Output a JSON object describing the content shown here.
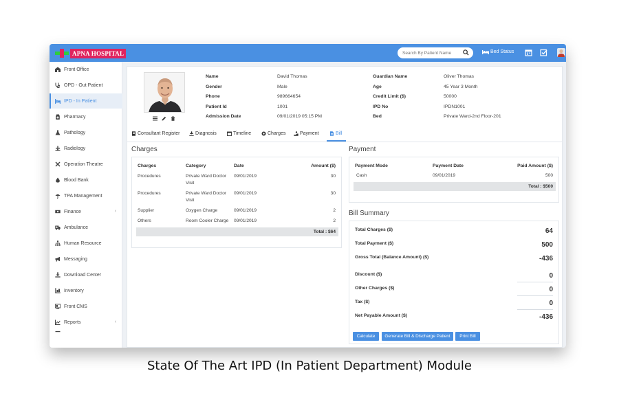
{
  "app": {
    "logo_text": "APNA HOSPITAL"
  },
  "topbar": {
    "search_placeholder": "Search By Patient Name",
    "bed_status": "Bed Status"
  },
  "sidebar": {
    "items": [
      {
        "label": "Front Office",
        "icon": "front-office-icon"
      },
      {
        "label": "OPD - Out Patient",
        "icon": "stethoscope-icon"
      },
      {
        "label": "IPD - In Patient",
        "icon": "bed-icon",
        "active": true
      },
      {
        "label": "Pharmacy",
        "icon": "pharmacy-icon"
      },
      {
        "label": "Pathology",
        "icon": "flask-icon"
      },
      {
        "label": "Radiology",
        "icon": "radiology-icon"
      },
      {
        "label": "Operation Theatre",
        "icon": "scissors-icon"
      },
      {
        "label": "Blood Bank",
        "icon": "blood-drop-icon"
      },
      {
        "label": "TPA Management",
        "icon": "umbrella-icon"
      },
      {
        "label": "Finance",
        "icon": "money-icon",
        "chevron": "‹"
      },
      {
        "label": "Ambulance",
        "icon": "ambulance-icon"
      },
      {
        "label": "Human Resource",
        "icon": "sitemap-icon"
      },
      {
        "label": "Messaging",
        "icon": "bullhorn-icon"
      },
      {
        "label": "Download Center",
        "icon": "download-icon"
      },
      {
        "label": "Inventory",
        "icon": "inventory-icon"
      },
      {
        "label": "Front CMS",
        "icon": "cms-icon"
      },
      {
        "label": "Reports",
        "icon": "chart-icon",
        "chevron": "‹"
      }
    ]
  },
  "patient": {
    "left": [
      {
        "label": "Name",
        "value": "David Thomas"
      },
      {
        "label": "Gender",
        "value": "Male"
      },
      {
        "label": "Phone",
        "value": "989664654"
      },
      {
        "label": "Patient Id",
        "value": "1001"
      },
      {
        "label": "Admission Date",
        "value": "09/01/2019 05:15 PM"
      }
    ],
    "right": [
      {
        "label": "Guardian Name",
        "value": "Oliver Thomas"
      },
      {
        "label": "Age",
        "value": "45 Year 3 Month"
      },
      {
        "label": "Credit Limit ($)",
        "value": "50000"
      },
      {
        "label": "IPD No",
        "value": "IPDN1001"
      },
      {
        "label": "Bed",
        "value": "Private Ward-2nd Floor-201"
      }
    ]
  },
  "tabs": [
    {
      "label": "Consultant Register",
      "icon": "register-icon"
    },
    {
      "label": "Diagnosis",
      "icon": "diagnosis-icon"
    },
    {
      "label": "Timeline",
      "icon": "calendar-icon"
    },
    {
      "label": "Charges",
      "icon": "charges-icon"
    },
    {
      "label": "Payment",
      "icon": "payment-icon"
    },
    {
      "label": "Bill",
      "icon": "file-icon",
      "active": true
    }
  ],
  "charges": {
    "title": "Charges",
    "headers": [
      "Charges",
      "Category",
      "Date",
      "Amount ($)"
    ],
    "rows": [
      {
        "charge": "Procedures",
        "category": "Private Ward Doctor Visit",
        "date": "09/01/2019",
        "amount": "30"
      },
      {
        "charge": "Procedures",
        "category": "Private Ward Doctor Visit",
        "date": "09/01/2019",
        "amount": "30"
      },
      {
        "charge": "Supplier",
        "category": "Oxygen Charge",
        "date": "09/01/2019",
        "amount": "2"
      },
      {
        "charge": "Others",
        "category": "Room Cooler Charge",
        "date": "09/01/2019",
        "amount": "2"
      }
    ],
    "total": "Total : $64"
  },
  "payment": {
    "title": "Payment",
    "headers": [
      "Payment Mode",
      "Payment Date",
      "Paid Amount ($)"
    ],
    "rows": [
      {
        "mode": "Cash",
        "date": "09/01/2019",
        "amount": "500"
      }
    ],
    "total": "Total : $500"
  },
  "bill_summary": {
    "title": "Bill Summary",
    "rows": [
      {
        "label": "Total Charges ($)",
        "value": "64"
      },
      {
        "label": "Total Payment ($)",
        "value": "500"
      },
      {
        "label": "Gross Total (Balance Amount) ($)",
        "value": "-436"
      },
      {
        "label": "Discount ($)",
        "value": "0"
      },
      {
        "label": "Other Charges ($)",
        "value": "0"
      },
      {
        "label": "Tax ($)",
        "value": "0"
      },
      {
        "label": "Net Payable Amount ($)",
        "value": "-436"
      }
    ],
    "buttons": {
      "calculate": "Calculate",
      "generate": "Generate Bill & Discharge Patient",
      "print": "Print Bill"
    }
  },
  "caption": "State Of The Art IPD (In Patient Department) Module",
  "colors": {
    "accent": "#4a90e2",
    "logo_red": "#e0245e",
    "logo_green": "#2ecc40"
  }
}
